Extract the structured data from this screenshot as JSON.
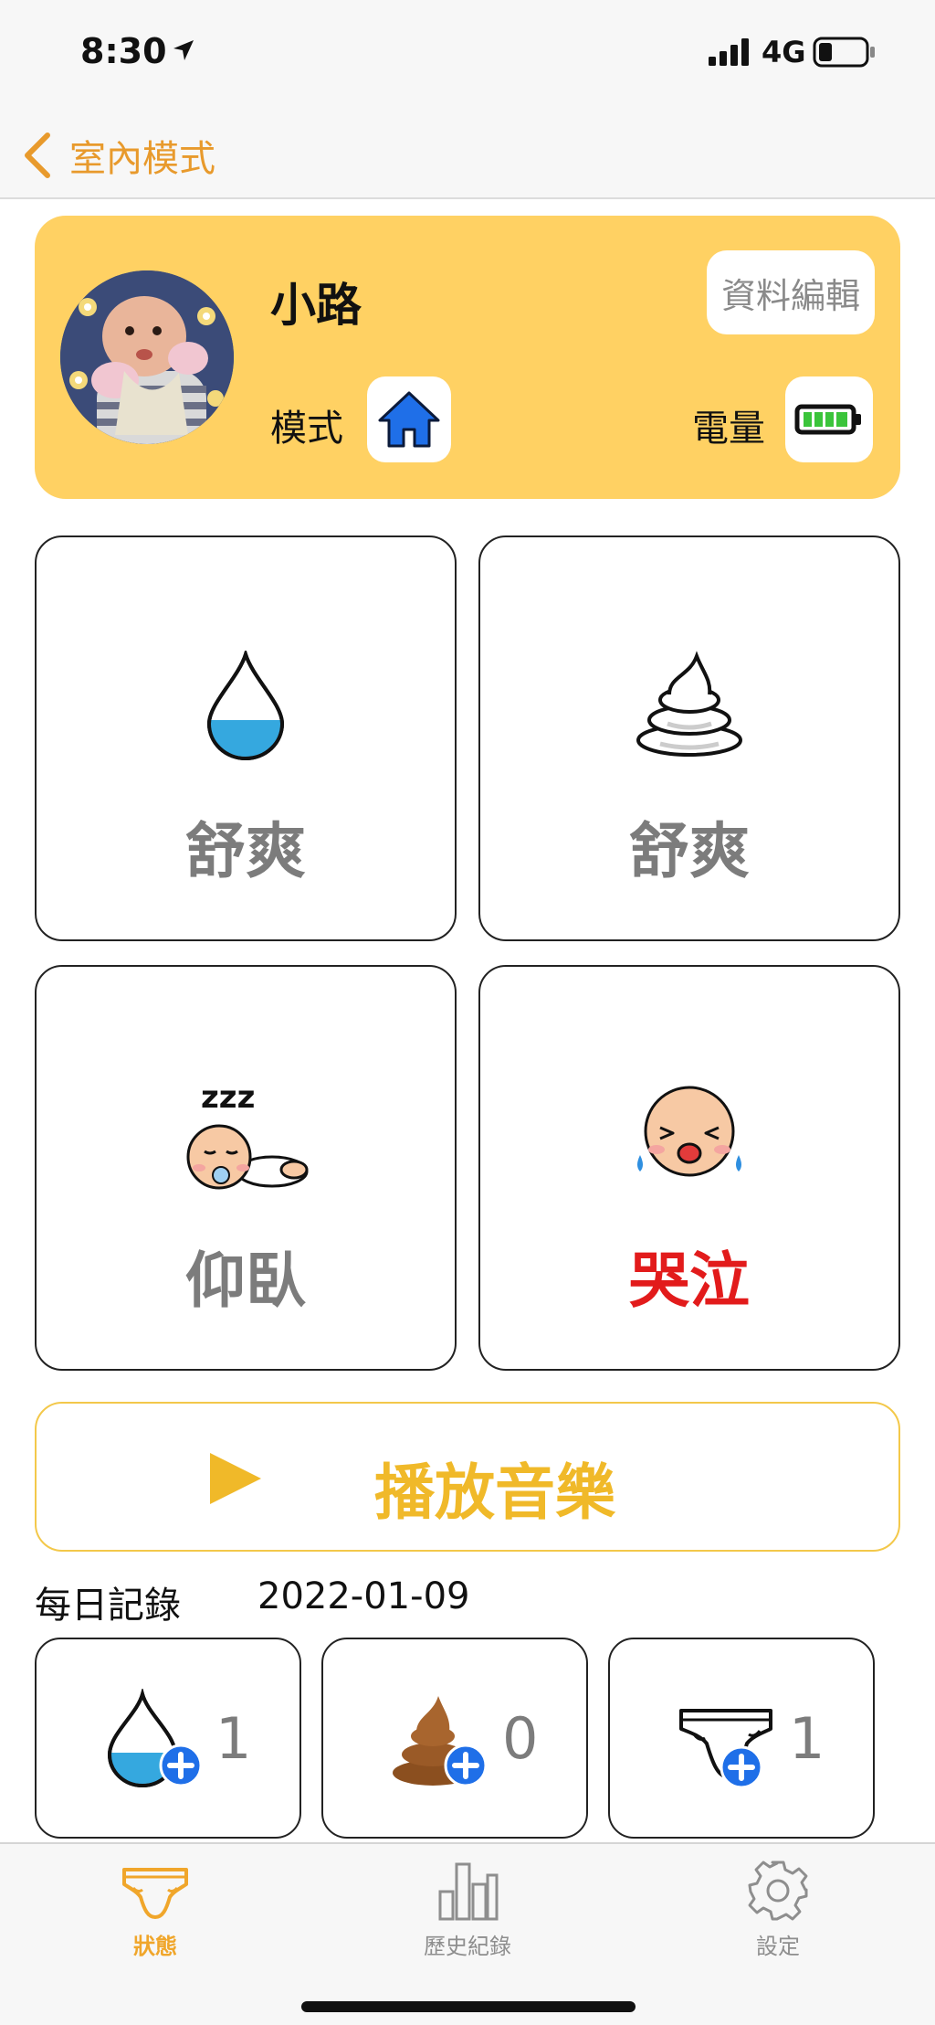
{
  "status_bar": {
    "time": "8:30",
    "network": "4G"
  },
  "nav": {
    "back_label": "室內模式"
  },
  "profile": {
    "name": "小路",
    "edit_label": "資料編輯",
    "mode_label": "模式",
    "mode_icon": "home-icon",
    "power_label": "電量",
    "battery_level": 1.0,
    "colors": {
      "card": "#ffd163",
      "mode_icon": "#1f6fe8",
      "battery": "#3bc43b"
    }
  },
  "status_tiles": [
    {
      "icon": "water-drop-icon",
      "label": "舒爽",
      "alert": false
    },
    {
      "icon": "poop-outline-icon",
      "label": "舒爽",
      "alert": false
    },
    {
      "icon": "sleeping-baby-icon",
      "label": "仰臥",
      "alert": false
    },
    {
      "icon": "crying-baby-icon",
      "label": "哭泣",
      "alert": true
    }
  ],
  "music": {
    "label": "播放音樂",
    "icon": "play-icon",
    "color": "#f0b929"
  },
  "daily_record": {
    "title": "每日記錄",
    "date": "2022-01-09",
    "items": [
      {
        "icon": "water-drop-add-icon",
        "count": "1"
      },
      {
        "icon": "poop-add-icon",
        "count": "0"
      },
      {
        "icon": "diaper-add-icon",
        "count": "1"
      }
    ]
  },
  "tabs": [
    {
      "label": "狀態",
      "icon": "diaper-icon",
      "active": true
    },
    {
      "label": "歷史紀錄",
      "icon": "bar-chart-icon",
      "active": false
    },
    {
      "label": "設定",
      "icon": "gear-icon",
      "active": false
    }
  ],
  "colors": {
    "accent": "#f0a62b",
    "alert": "#e21b1b"
  }
}
